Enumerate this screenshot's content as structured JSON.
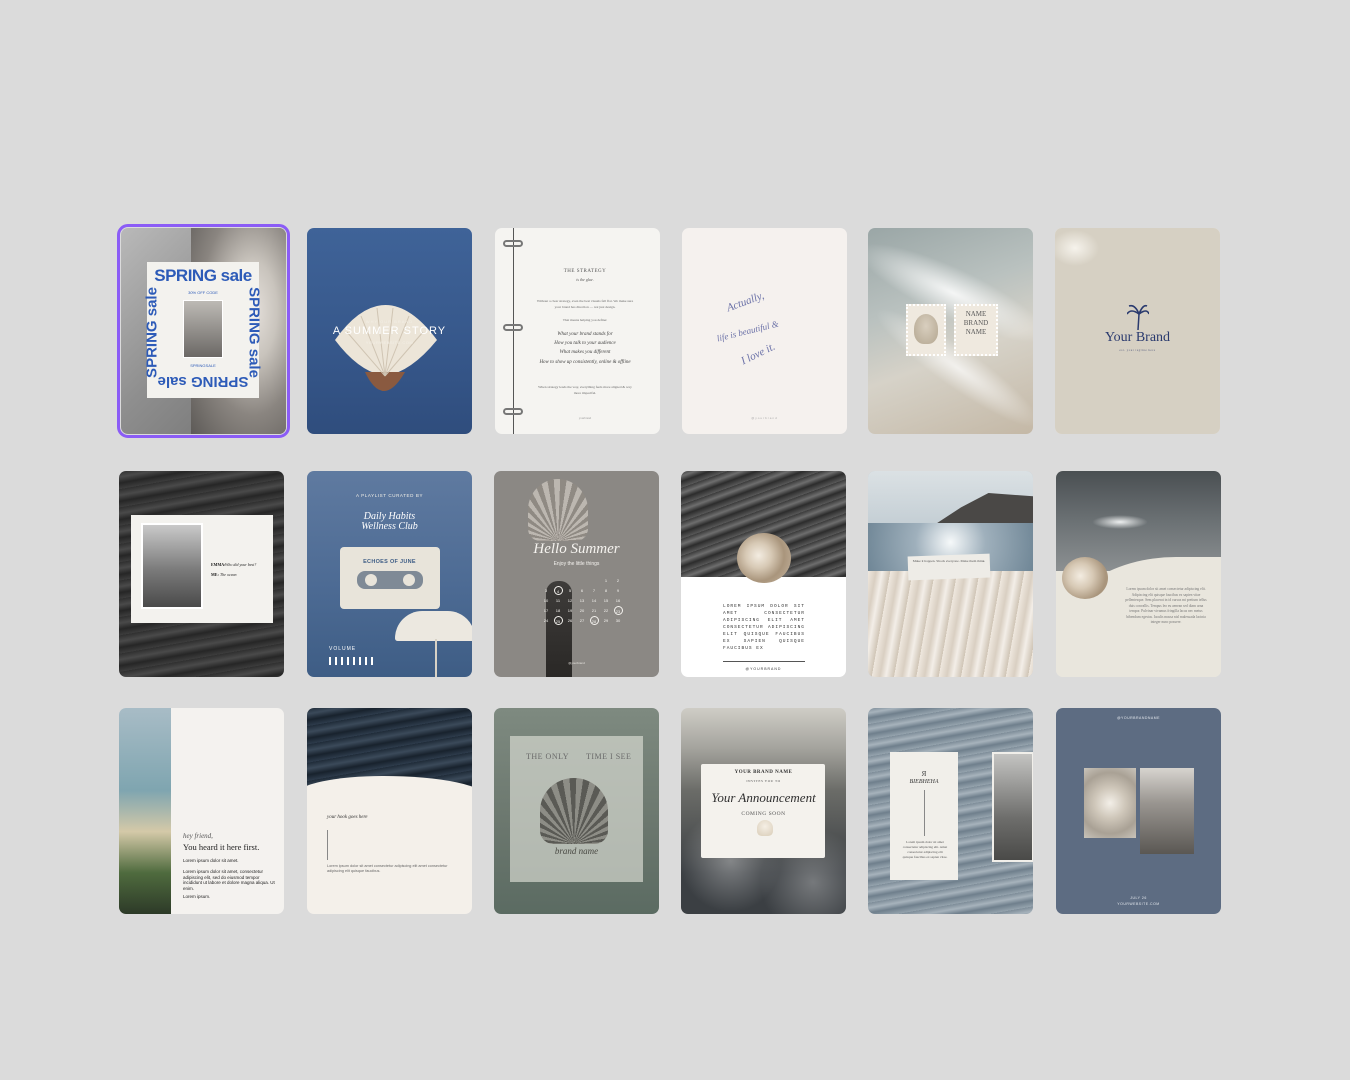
{
  "colors": {
    "background": "#dbdbdb",
    "selection": "#8b5cf6",
    "spring_blue": "#2d5bb8",
    "ocean_blue": "#3d5f92",
    "slate": "#5d6c82"
  },
  "templates": [
    {
      "id": "spring-sale",
      "selected": true,
      "headline": "SPRING sale",
      "left_word": "SPRING sale",
      "right_word": "SPRING sale",
      "bottom_word": "SPRING sale",
      "offer": "30% OFF CODE",
      "code": "SPRINGSALE"
    },
    {
      "id": "summer-story",
      "eyebrow": "WHY OUR BRAND",
      "title": "A SUMMER STORY",
      "url": "YOURWEBSITE.COM"
    },
    {
      "id": "the-strategy",
      "title": "THE STRATEGY",
      "subtitle": "is the glue.",
      "intro": "Without a clear strategy, even the best visuals fall flat. We make sure your brand has direction — not just design.",
      "lead": "That means helping you define:",
      "items": [
        "What your brand stands for",
        "How you talk to your audience",
        "What makes you different",
        "How to show up consistently, online & offline"
      ],
      "closing": "When strategy leads the way, everything feels more aligned & way more impactful.",
      "handle": "yourbrand"
    },
    {
      "id": "script-quote",
      "line1": "Actually,",
      "line2": "life is beautiful &",
      "line3": "I love it.",
      "footer": "@yourbrand"
    },
    {
      "id": "stamps",
      "stamp_text": "NAME BRAND NAME"
    },
    {
      "id": "your-brand",
      "brand": "Your Brand",
      "tagline": "est. your tagline here"
    },
    {
      "id": "interview",
      "q_label": "EMMA:",
      "question": "Who did your best?",
      "a_label": "ME:",
      "answer": "The ocean"
    },
    {
      "id": "playlist",
      "eyebrow": "A PLAYLIST CURATED BY",
      "title_line1": "Daily Habits",
      "title_line2": "Wellness Club",
      "tape_label": "ECHOES OF JUNE",
      "volume": "VOLUME"
    },
    {
      "id": "hello-summer",
      "title": "Hello Summer",
      "subtitle": "Enjoy the little things",
      "days": [
        "1",
        "2",
        "3",
        "4",
        "5",
        "6",
        "7",
        "8",
        "9",
        "10",
        "11",
        "12",
        "13",
        "14",
        "15",
        "16",
        "17",
        "18",
        "19",
        "20",
        "21",
        "22",
        "23",
        "24",
        "25",
        "26",
        "27",
        "28",
        "29",
        "30"
      ],
      "highlight_days": [
        "4",
        "23",
        "25",
        "28"
      ],
      "handle": "@yourbrand"
    },
    {
      "id": "nautilus-text",
      "body": "LOREM IPSUM DOLOR SIT AMET CONSECTETUR ADIPISCING ELIT AMET CONSECTETUR ADIPISCING ELIT QUISQUE FAUCIBUS EX SAPIEN QUISQUE FAUCIBUS EX",
      "footer": "@YOURBRAND"
    },
    {
      "id": "cliff-note",
      "note": "Make it happen. Shock everyone. Make them think."
    },
    {
      "id": "wave-text",
      "body": "Lorem ipsum dolor sit amet consectetur adipiscing elit. Adipiscing elit quisque faucibus ex sapien vitae pellentesque. Sem placerat in id cursus mi pretium tellus duis convallis. Tempus leo eu aenean sed diam urna tempor. Pulvinar vivamus fringilla lacus nec metus bibendum egestas. Iaculis massa nisl malesuada lacinia integer nunc posuere."
    },
    {
      "id": "beach-note",
      "script": "hey friend,",
      "headline": "You heard it here first.",
      "p1": "Lorem ipsum dolor sit amet.",
      "p2": "Lorem ipsum dolor sit amet, consectetur adipiscing elit, sed do eiusmod tempor incididunt ut labore et dolore magna aliqua. Ut enim.",
      "p3": "Lorem ipsum."
    },
    {
      "id": "hook",
      "hook": "your hook goes here",
      "body": "Lorem ipsum dolor sit amet consectetur adipiscing elit amet consectetur adipiscing elit quisque faucibus."
    },
    {
      "id": "only-time",
      "left": "THE ONLY",
      "right": "TIME I SEE",
      "script": "brand name"
    },
    {
      "id": "announcement",
      "brand": "YOUR BRAND NAME",
      "invite": "INVITES YOU TO",
      "script": "Your Announcement",
      "coming": "COMING SOON"
    },
    {
      "id": "journal",
      "icon_text": "Я",
      "title": "BIEBHEHA",
      "body": "Lorem ipsum dolor sit amet consectetur adipiscing elit. Amet consectetur adipiscing elit quisque faucibus ex sapien vitae."
    },
    {
      "id": "portrait-shell",
      "handle": "@YOURBRANDNAME",
      "date": "JULY 26",
      "url": "YOURWEBSITE.COM"
    }
  ]
}
